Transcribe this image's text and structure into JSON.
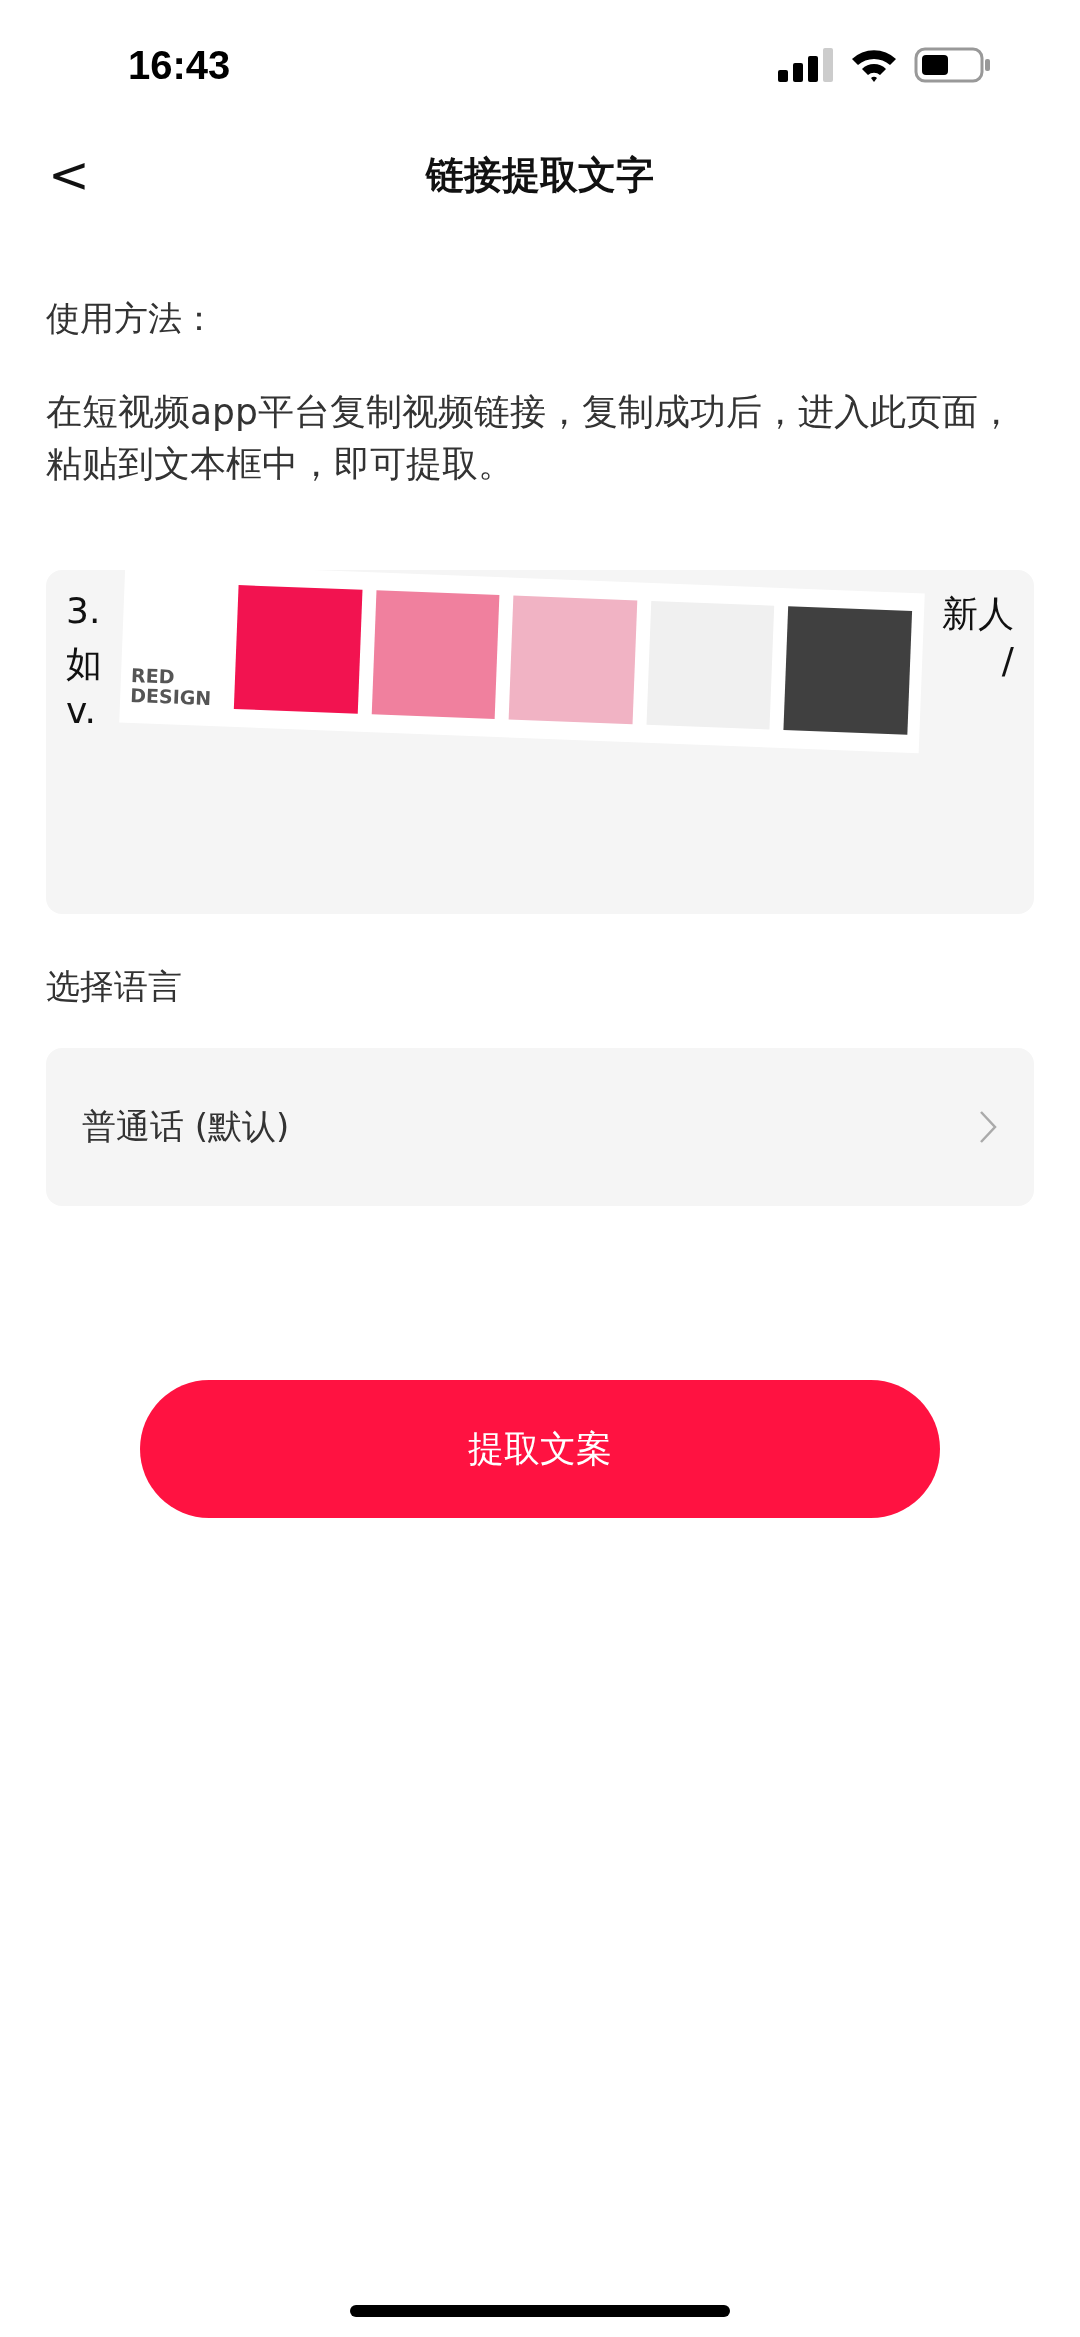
{
  "status_bar": {
    "time": "16:43"
  },
  "nav": {
    "back": "<",
    "title": "链接提取文字"
  },
  "usage": {
    "heading": "使用方法：",
    "text": "在短视频app平台复制视频链接，复制成功后，进入此页面，粘贴到文本框中，即可提取。"
  },
  "link_field": {
    "lines": [
      {
        "start": "3.",
        "end": "新人"
      },
      {
        "start": "如",
        "end": "/"
      },
      {
        "start": "v."
      }
    ]
  },
  "overlay": {
    "label": "RED\nDESIGN",
    "swatches": [
      {
        "color": "#f21350"
      },
      {
        "color": "#f0809e"
      },
      {
        "color": "#f1b3c4"
      },
      {
        "color": "#f0f0f0"
      },
      {
        "color": "#404040"
      }
    ]
  },
  "language": {
    "heading": "选择语言",
    "value": "普通话 (默认)"
  },
  "submit": {
    "label": "提取文案"
  }
}
